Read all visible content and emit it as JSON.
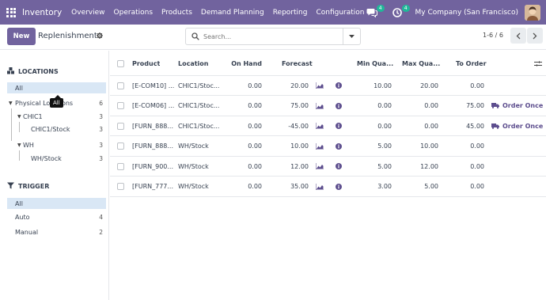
{
  "navbar": {
    "brand": "Inventory",
    "menu": [
      "Overview",
      "Operations",
      "Products",
      "Demand Planning",
      "Reporting",
      "Configuration"
    ],
    "messages_count": "4",
    "activities_count": "4",
    "company": "My Company (San Francisco)"
  },
  "control": {
    "new_label": "New",
    "title": "Replenishment",
    "search_placeholder": "Search...",
    "pager": "1-6 / 6"
  },
  "sidebar": {
    "locations_title": "LOCATIONS",
    "all_label": "All",
    "tooltip": "All",
    "tree": [
      {
        "label": "Physical Locations",
        "count": "6"
      },
      {
        "label": "CHIC1",
        "count": "3"
      },
      {
        "label": "CHIC1/Stock",
        "count": "3"
      },
      {
        "label": "WH",
        "count": "3"
      },
      {
        "label": "WH/Stock",
        "count": "3"
      }
    ],
    "trigger_title": "TRIGGER",
    "trigger_items": [
      {
        "label": "All",
        "count": ""
      },
      {
        "label": "Auto",
        "count": "4"
      },
      {
        "label": "Manual",
        "count": "2"
      }
    ]
  },
  "table": {
    "headers": {
      "product": "Product",
      "location": "Location",
      "on_hand": "On Hand",
      "forecast": "Forecast",
      "min_qty": "Min Qua...",
      "max_qty": "Max Qua...",
      "to_order": "To Order"
    },
    "rows": [
      {
        "product": "[E-COM10] ...",
        "location": "CHIC1/Stoc...",
        "on_hand": "0.00",
        "forecast": "20.00",
        "min": "10.00",
        "max": "20.00",
        "to_order": "0.00",
        "action": ""
      },
      {
        "product": "[E-COM06] ...",
        "location": "CHIC1/Stoc...",
        "on_hand": "0.00",
        "forecast": "75.00",
        "min": "0.00",
        "max": "0.00",
        "to_order": "75.00",
        "action": "Order Once"
      },
      {
        "product": "[FURN_888...",
        "location": "CHIC1/Stoc...",
        "on_hand": "0.00",
        "forecast": "-45.00",
        "min": "0.00",
        "max": "0.00",
        "to_order": "45.00",
        "action": "Order Once"
      },
      {
        "product": "[FURN_888...",
        "location": "WH/Stock",
        "on_hand": "0.00",
        "forecast": "10.00",
        "min": "5.00",
        "max": "10.00",
        "to_order": "0.00",
        "action": ""
      },
      {
        "product": "[FURN_900...",
        "location": "WH/Stock",
        "on_hand": "0.00",
        "forecast": "12.00",
        "min": "5.00",
        "max": "12.00",
        "to_order": "0.00",
        "action": ""
      },
      {
        "product": "[FURN_777...",
        "location": "WH/Stock",
        "on_hand": "0.00",
        "forecast": "35.00",
        "min": "3.00",
        "max": "5.00",
        "to_order": "0.00",
        "action": ""
      }
    ]
  },
  "colors": {
    "brand": "#71639e",
    "active_filter": "#d9e7f5",
    "badge": "#21b799",
    "order_link": "#5d4e8e"
  },
  "icons": {
    "apps": "apps-grid-icon",
    "gear": "gear-icon",
    "search": "search-icon",
    "chart": "area-chart-icon",
    "info": "info-circle-icon",
    "truck": "truck-icon"
  }
}
